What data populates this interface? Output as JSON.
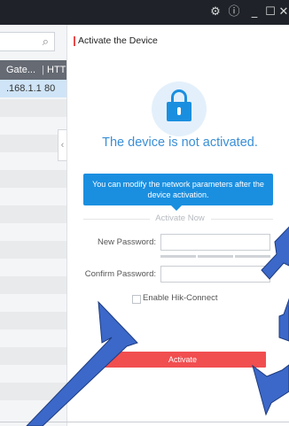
{
  "titlebar": {
    "icons": [
      "gear-icon",
      "info-icon",
      "minimize-icon",
      "maximize-icon",
      "close-icon"
    ],
    "glyphs": {
      "gear": "⚙",
      "info": "ⓘ",
      "minimize": "_",
      "maximize": "☐",
      "close": "✕"
    }
  },
  "device_list": {
    "search_icon": "⌕",
    "columns": [
      "Gate...",
      "HTTP"
    ],
    "rows": [
      {
        "gateway": ".168.1.1",
        "http": "80",
        "selected": true
      }
    ]
  },
  "collapse_glyph": "‹",
  "panel": {
    "title": "Activate the Device",
    "status": "The device is not activated.",
    "info": "You can modify the network parameters after the device activation.",
    "section": "Activate Now",
    "new_password_label": "New Password:",
    "new_password_value": "",
    "confirm_password_label": "Confirm Password:",
    "confirm_password_value": "",
    "enable_hik_connect_label": "Enable Hik-Connect",
    "enable_hik_connect_checked": false,
    "activate_button": "Activate"
  },
  "colors": {
    "accent_blue": "#1a8fe0",
    "status_text": "#3a8fd6",
    "activate_red": "#f14e50",
    "titlebar": "#1f2329",
    "header_gray": "#656a73",
    "annotation_arrow": "#3b68c9"
  }
}
